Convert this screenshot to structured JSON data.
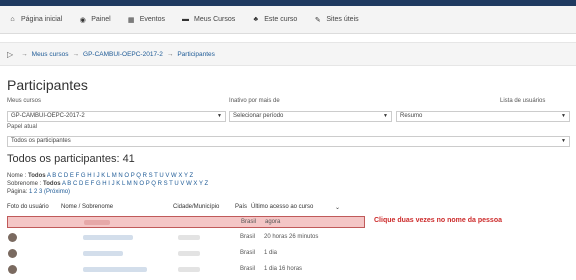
{
  "colors": {
    "accent": "#1f3a60",
    "link": "#1d5a96",
    "highlight": "#f4c6c6",
    "hint_text": "#cc2a2a"
  },
  "nav": {
    "items": [
      {
        "icon": "home-icon",
        "glyph": "⌂",
        "label": "Página inicial"
      },
      {
        "icon": "dashboard-icon",
        "glyph": "◉",
        "label": "Painel"
      },
      {
        "icon": "calendar-icon",
        "glyph": "▦",
        "label": "Eventos"
      },
      {
        "icon": "courses-icon",
        "glyph": "▬",
        "label": "Meus Cursos"
      },
      {
        "icon": "course-icon",
        "glyph": "♣",
        "label": "Este curso"
      },
      {
        "icon": "wrench-icon",
        "glyph": "✎",
        "label": "Sites úteis"
      }
    ]
  },
  "breadcrumb": {
    "glyph": "▷",
    "arrow": "→",
    "items": [
      "Meus cursos",
      "GP-CAMBUI-OEPC-2017-2",
      "Participantes"
    ]
  },
  "page_title": "Participantes",
  "filters": {
    "my_courses_label": "Meus cursos",
    "my_courses_value": "GP-CAMBUI-OEPC-2017-2",
    "inactive_label": "Inativo por mais de",
    "inactive_value": "Selecionar período",
    "user_list_label": "Lista de usuários",
    "user_list_value": "Resumo",
    "role_label": "Papel atual",
    "role_value": "Todos os participantes",
    "caret": "▼"
  },
  "section_title": "Todos os participantes: 41",
  "alphabet": {
    "name_label": "Nome : ",
    "name_all": "Todos",
    "surname_label": "Sobrenome : ",
    "surname_all": "Todos",
    "letters": "A B C D E F G H I J K L M N O P Q R S T U V W X Y Z",
    "pages_label": "Página: ",
    "pages": "1 2 3 (Próximo)"
  },
  "table": {
    "headers": {
      "photo": "Foto do usuário",
      "name": "Nome / Sobrenome",
      "city": "Cidade/Município",
      "country": "País",
      "last_access": "Último acesso ao curso"
    },
    "sort_icon": "⌄",
    "rows": [
      {
        "country": "Brasil",
        "last_access": "agora",
        "highlight": true
      },
      {
        "country": "Brasil",
        "last_access": "20 horas 26 minutos",
        "highlight": false
      },
      {
        "country": "Brasil",
        "last_access": "1 dia",
        "highlight": false
      },
      {
        "country": "Brasil",
        "last_access": "1 dia 16 horas",
        "highlight": false
      }
    ]
  },
  "hint": "Clique duas vezes no nome da pessoa"
}
